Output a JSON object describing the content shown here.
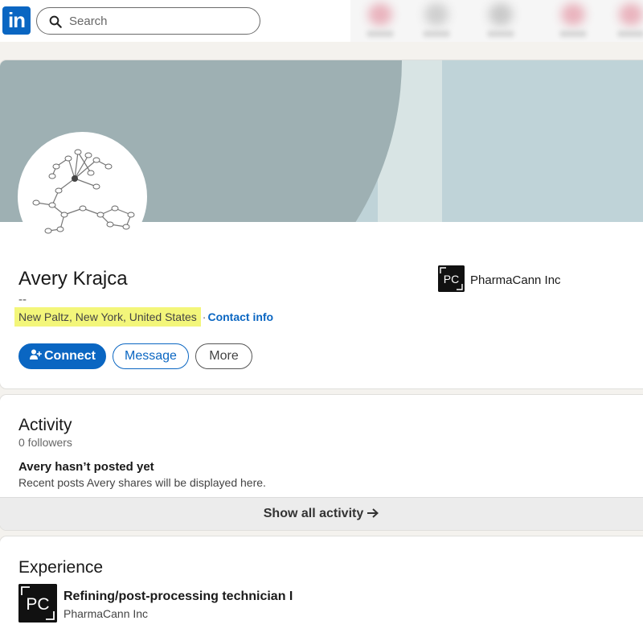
{
  "nav": {
    "search_placeholder": "Search",
    "logo_text": "in"
  },
  "colors": {
    "brand": "#0a66c2",
    "highlight": "#f3f67a"
  },
  "profile": {
    "name": "Avery Krajca",
    "headline": "--",
    "location": "New Paltz, New York, United States",
    "separator": "·",
    "contact_info": "Contact info",
    "current_company": "PharmaCann Inc",
    "company_logo_text": "PC",
    "buttons": {
      "connect": "Connect",
      "message": "Message",
      "more": "More"
    }
  },
  "activity": {
    "title": "Activity",
    "followers": "0 followers",
    "empty_title": "Avery hasn’t posted yet",
    "empty_sub": "Recent posts Avery shares will be displayed here.",
    "show_all": "Show all activity"
  },
  "experience": {
    "title": "Experience",
    "items": [
      {
        "role": "Refining/post-processing technician I",
        "company": "PharmaCann Inc",
        "logo_text": "PC"
      }
    ]
  }
}
